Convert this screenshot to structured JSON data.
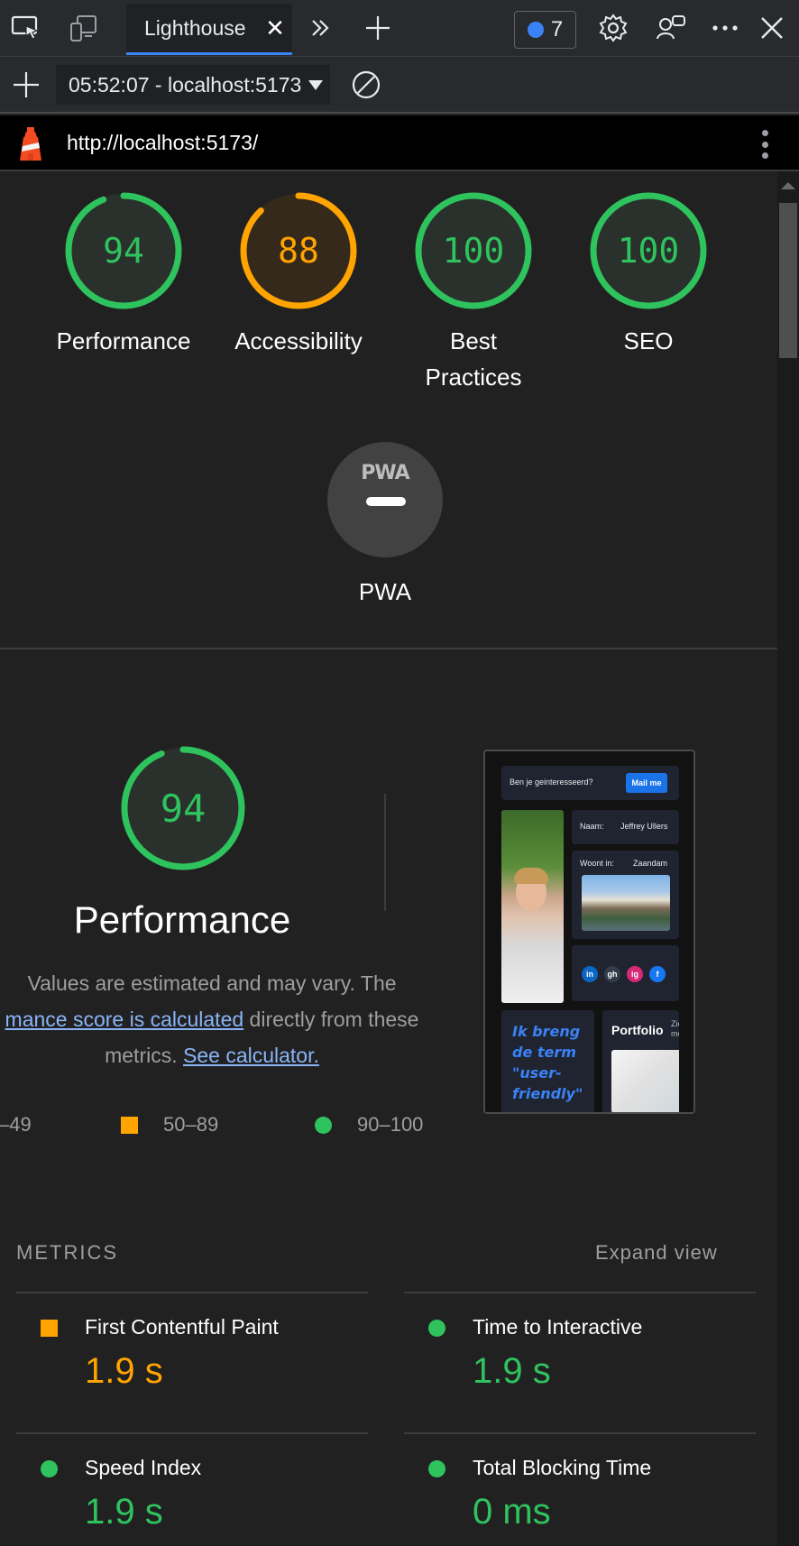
{
  "devtools": {
    "active_tab": "Lighthouse",
    "issues_count": "7"
  },
  "report_bar": {
    "selected_report": "05:52:07 - localhost:5173"
  },
  "url_bar": {
    "url": "http://localhost:5173/"
  },
  "scores": {
    "performance": {
      "value": "94",
      "label": "Performance",
      "fraction": 0.94,
      "color": "#2fc35e"
    },
    "accessibility": {
      "value": "88",
      "label": "Accessibility",
      "fraction": 0.88,
      "color": "#ffa400"
    },
    "best_practices": {
      "value": "100",
      "label_line1": "Best",
      "label_line2": "Practices",
      "fraction": 1.0,
      "color": "#2fc35e"
    },
    "seo": {
      "value": "100",
      "label": "SEO",
      "fraction": 1.0,
      "color": "#2fc35e"
    },
    "pwa": {
      "badge": "PWA",
      "label": "PWA"
    }
  },
  "performance_section": {
    "score": "94",
    "fraction": 0.94,
    "title": "Performance",
    "desc_line1": "Values are estimated and may vary. The",
    "desc_link": "mance score is calculated",
    "desc_line2_rest": " directly from these",
    "desc_line3": "metrics. ",
    "calc_link": "See calculator.",
    "legend": {
      "range_fail": "–49",
      "range_average": "50–89",
      "range_pass": "90–100"
    }
  },
  "thumbnail": {
    "banner_text": "Ben je geinteresseerd?",
    "banner_button": "Mail me",
    "name_label": "Naam:",
    "name_value": "Jeffrey Ullers",
    "city_label": "Woont in:",
    "city_value": "Zaandam",
    "quote": "Ik breng de term \"user-friendly\"",
    "portfolio": "Portfolio",
    "portfolio_more": "Zie meer",
    "social": [
      "in",
      "gh",
      "ig",
      "f"
    ]
  },
  "metrics": {
    "heading": "METRICS",
    "expand": "Expand view",
    "items": [
      {
        "label": "First Contentful Paint",
        "value": "1.9 s",
        "status": "average",
        "color": "#ffa400"
      },
      {
        "label": "Time to Interactive",
        "value": "1.9 s",
        "status": "pass",
        "color": "#2fc35e"
      },
      {
        "label": "Speed Index",
        "value": "1.9 s",
        "status": "pass",
        "color": "#2fc35e"
      },
      {
        "label": "Total Blocking Time",
        "value": "0 ms",
        "status": "pass",
        "color": "#2fc35e"
      }
    ]
  },
  "colors": {
    "pass": "#2fc35e",
    "average": "#ffa400",
    "accent": "#3b82f6"
  }
}
